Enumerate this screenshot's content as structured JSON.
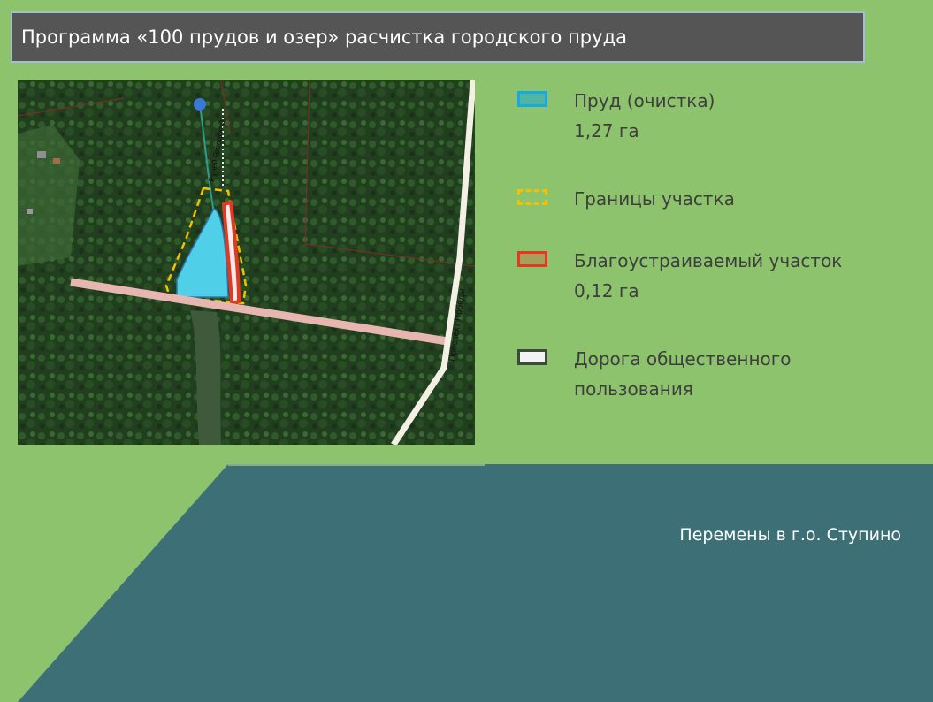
{
  "title": "Программа «100 прудов и озер» расчистка городского пруда",
  "map": {
    "stream_label": "Ручей Городской",
    "road_label": "Проспект Победы"
  },
  "legend": [
    {
      "label": "Пруд (очистка)",
      "sub": "1,27 га",
      "icon": "pond-swatch-icon"
    },
    {
      "label": "Границы участка",
      "sub": "",
      "icon": "boundary-swatch-icon"
    },
    {
      "label": "Благоустраиваемый участок",
      "sub": "0,12 га",
      "icon": "improved-area-swatch-icon"
    },
    {
      "label": "Дорога общественного",
      "sub": "пользования",
      "icon": "road-swatch-icon"
    }
  ],
  "footer": "Перемены в г.о. Ступино",
  "colors": {
    "background": "#8dc36d",
    "panel": "#3d7076",
    "title_bar": "#555555",
    "pond": "#4fd0e8",
    "boundary": "#f2c200",
    "improved_area": "#e03b22",
    "road": "#f2f2f2"
  }
}
